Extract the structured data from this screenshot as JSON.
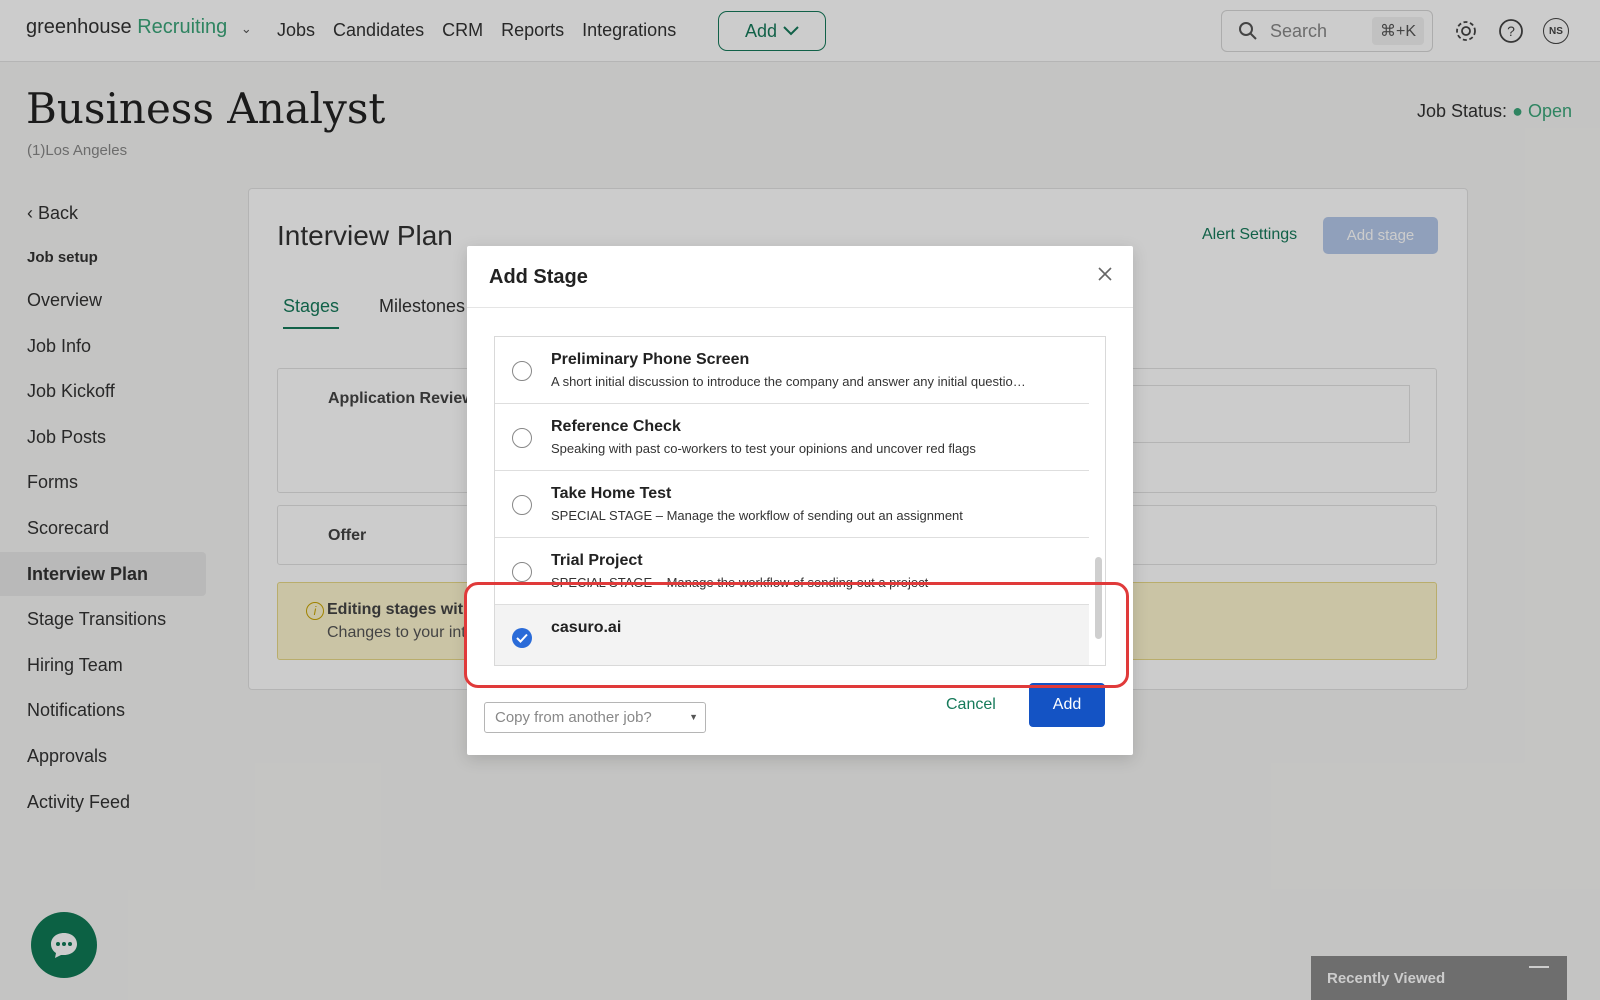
{
  "nav": {
    "brand_main": "greenhouse",
    "brand_accent": "Recruiting",
    "links": [
      "Jobs",
      "Candidates",
      "CRM",
      "Reports",
      "Integrations"
    ],
    "add_label": "Add",
    "search_placeholder": "Search",
    "search_shortcut": "⌘+K",
    "avatar_initials": "NS"
  },
  "header": {
    "title": "Business Analyst",
    "subtitle": "(1)Los Angeles",
    "status_label": "Job Status:",
    "status_value": "Open"
  },
  "sidebar": {
    "back_label": "Back",
    "heading": "Job setup",
    "items": [
      {
        "label": "Overview"
      },
      {
        "label": "Job Info"
      },
      {
        "label": "Job Kickoff"
      },
      {
        "label": "Job Posts"
      },
      {
        "label": "Forms"
      },
      {
        "label": "Scorecard"
      },
      {
        "label": "Interview Plan",
        "active": true
      },
      {
        "label": "Stage Transitions"
      },
      {
        "label": "Hiring Team"
      },
      {
        "label": "Notifications"
      },
      {
        "label": "Approvals"
      },
      {
        "label": "Activity Feed"
      }
    ]
  },
  "main": {
    "title": "Interview Plan",
    "alert_settings": "Alert Settings",
    "add_stage": "Add stage",
    "tabs": [
      "Stages",
      "Milestones"
    ],
    "stages": [
      "Application Review",
      "Offer"
    ],
    "warning_title": "Editing stages with",
    "warning_text": "Changes to your int"
  },
  "modal": {
    "title": "Add Stage",
    "options": [
      {
        "name": "Preliminary Phone Screen",
        "desc": "A short initial discussion to introduce the company and answer any initial questio…",
        "checked": false
      },
      {
        "name": "Reference Check",
        "desc": "Speaking with past co-workers to test your opinions and uncover red flags",
        "checked": false
      },
      {
        "name": "Take Home Test",
        "desc": "SPECIAL STAGE – Manage the workflow of sending out an assignment",
        "checked": false
      },
      {
        "name": "Trial Project",
        "desc": "SPECIAL STAGE – Manage the workflow of sending out a project",
        "checked": false
      },
      {
        "name": "casuro.ai",
        "desc": "",
        "checked": true
      }
    ],
    "copy_placeholder": "Copy from another job?",
    "cancel_label": "Cancel",
    "add_label": "Add"
  },
  "footer": {
    "recently_viewed": "Recently Viewed"
  },
  "colors": {
    "brand_green": "#167a5a",
    "accent_green": "#3ba57a",
    "primary_blue": "#1453c4",
    "highlight_red": "#e03a3a"
  }
}
